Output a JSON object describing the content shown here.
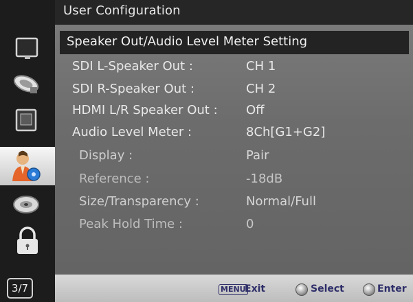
{
  "window": {
    "title": "User Configuration"
  },
  "section": {
    "title": "Speaker Out/Audio Level Meter Setting"
  },
  "settings": [
    {
      "label": "SDI L-Speaker Out :",
      "value": "CH 1"
    },
    {
      "label": "SDI R-Speaker Out :",
      "value": "CH 2"
    },
    {
      "label": "HDMI L/R Speaker Out :",
      "value": "Off"
    },
    {
      "label": "Audio Level Meter :",
      "value": "8Ch[G1+G2]"
    },
    {
      "label": "Display :",
      "value": "Pair"
    },
    {
      "label": "Reference :",
      "value": "-18dB"
    },
    {
      "label": "Size/Transparency :",
      "value": "Normal/Full"
    },
    {
      "label": "Peak Hold Time :",
      "value": "0"
    }
  ],
  "sidebar": {
    "icons": [
      "monitor-icon",
      "satellite-dish-icon",
      "display-frame-icon",
      "user-config-icon",
      "disc-icon",
      "lock-icon"
    ],
    "selected_index": 3,
    "page_indicator": "3/7"
  },
  "footer": {
    "menu_key": "MENU",
    "exit_label": "Exit",
    "select_label": "Select",
    "enter_label": "Enter"
  }
}
